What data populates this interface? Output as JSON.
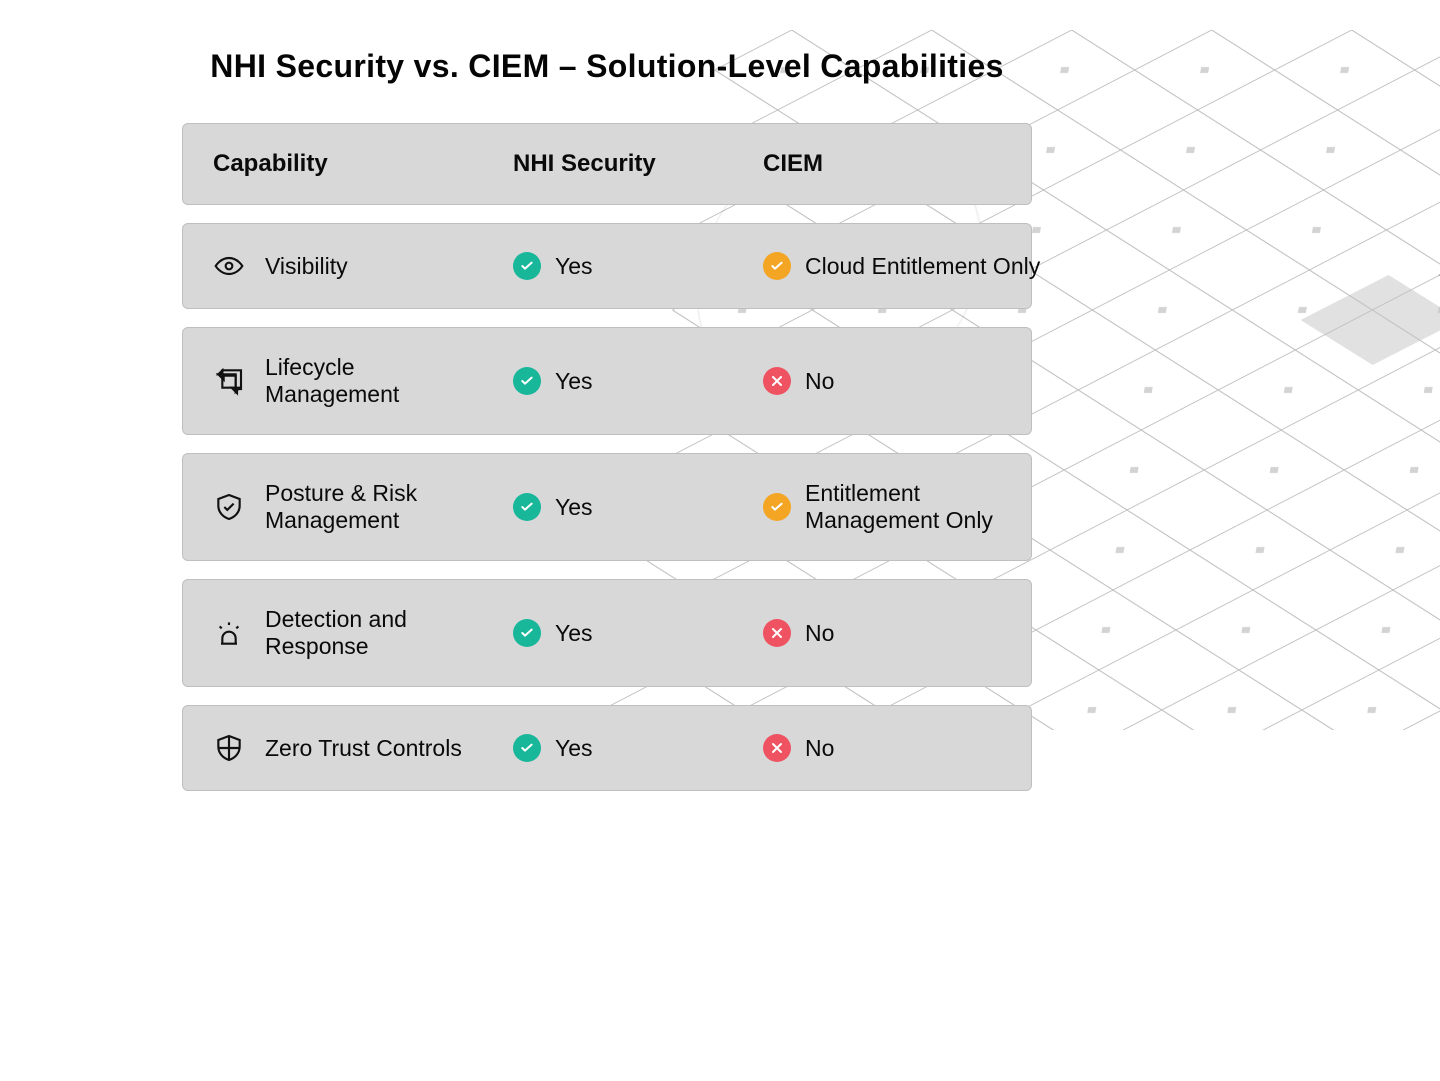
{
  "title": "NHI Security vs. CIEM – Solution-Level Capabilities",
  "columns": {
    "capability": "Capability",
    "nhi": "NHI Security",
    "ciem": "CIEM"
  },
  "rows": [
    {
      "icon": "eye-icon",
      "capability": "Visibility",
      "nhi": {
        "status": "yes",
        "text": "Yes"
      },
      "ciem": {
        "status": "partial",
        "text": "Cloud Entitlement Only"
      }
    },
    {
      "icon": "cycle-icon",
      "capability": "Lifecycle Management",
      "nhi": {
        "status": "yes",
        "text": "Yes"
      },
      "ciem": {
        "status": "no",
        "text": "No"
      }
    },
    {
      "icon": "shield-check-icon",
      "capability": "Posture & Risk Management",
      "nhi": {
        "status": "yes",
        "text": "Yes"
      },
      "ciem": {
        "status": "partial",
        "text": "Entitlement Management Only"
      }
    },
    {
      "icon": "siren-icon",
      "capability": "Detection and Response",
      "nhi": {
        "status": "yes",
        "text": "Yes"
      },
      "ciem": {
        "status": "no",
        "text": "No"
      }
    },
    {
      "icon": "shield-grid-icon",
      "capability": "Zero Trust Controls",
      "nhi": {
        "status": "yes",
        "text": "Yes"
      },
      "ciem": {
        "status": "no",
        "text": "No"
      }
    }
  ]
}
